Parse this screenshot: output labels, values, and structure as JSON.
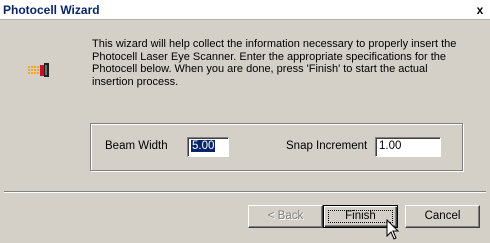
{
  "window": {
    "title": "Photocell Wizard",
    "close_glyph": "x"
  },
  "icon": {
    "name": "photocell-scanner-icon"
  },
  "intro_text": "This wizard will help collect the information necessary to properly insert the\nPhotocell Laser Eye Scanner.  Enter the appropriate specifications for the\nPhotocell below.  When you are done, press 'Finish' to start the actual\ninsertion process.",
  "fields": {
    "beam_width": {
      "label": "Beam Width",
      "value": "5.00"
    },
    "snap_increment": {
      "label": "Snap Increment",
      "value": "1.00"
    }
  },
  "buttons": {
    "back": "< Back",
    "finish": "Finish",
    "cancel": "Cancel"
  },
  "colors": {
    "title_text": "#0a246a",
    "dialog_bg": "#d4d0c8",
    "icon_orange": "#f5a623",
    "selection": "#0a246a"
  }
}
